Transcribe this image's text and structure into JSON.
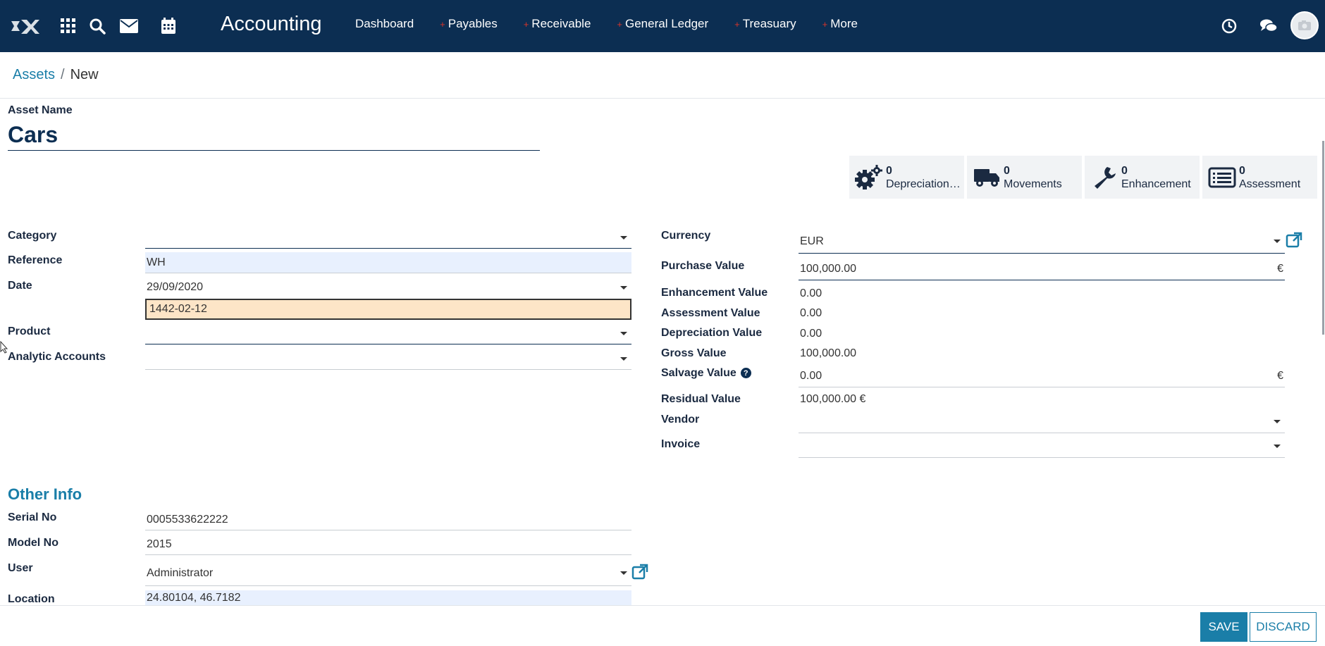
{
  "app": {
    "title": "Accounting",
    "colors": {
      "navbar": "#0c2e52",
      "accent": "#1a7ea8",
      "required_bg": "#e8f0fe",
      "focus_bg": "#fde5c7"
    }
  },
  "nav": {
    "icons": [
      "apps-grid-icon",
      "search-icon",
      "mail-icon",
      "calendar-icon"
    ],
    "menu": [
      {
        "label": "Dashboard",
        "plus": ""
      },
      {
        "label": "Payables",
        "plus": "+"
      },
      {
        "label": "Receivable",
        "plus": "+"
      },
      {
        "label": "General Ledger",
        "plus": "+"
      },
      {
        "label": "Treasuary",
        "plus": "+"
      },
      {
        "label": "More",
        "plus": "+"
      }
    ]
  },
  "breadcrumb": {
    "parent": "Assets",
    "sep": "/",
    "current": "New"
  },
  "asset": {
    "label": "Asset Name",
    "name": "Cars"
  },
  "smart_buttons": [
    {
      "count": "0",
      "label": "Depreciations..."
    },
    {
      "count": "0",
      "label": "Movements"
    },
    {
      "count": "0",
      "label": "Enhancement"
    },
    {
      "count": "0",
      "label": "Assessment"
    }
  ],
  "left_fields": {
    "category": {
      "label": "Category",
      "value": ""
    },
    "reference": {
      "label": "Reference",
      "value": "WH"
    },
    "date": {
      "label": "Date",
      "value": "29/09/2020",
      "hijri": "1442-02-12"
    },
    "product": {
      "label": "Product",
      "value": ""
    },
    "analytic": {
      "label": "Analytic Accounts",
      "value": ""
    }
  },
  "right_fields": {
    "currency": {
      "label": "Currency",
      "value": "EUR"
    },
    "purchase": {
      "label": "Purchase Value",
      "value": "100,000.00",
      "symbol": "€"
    },
    "enhancement": {
      "label": "Enhancement Value",
      "value": "0.00"
    },
    "assessment": {
      "label": "Assessment Value",
      "value": "0.00"
    },
    "depreciation": {
      "label": "Depreciation Value",
      "value": "0.00"
    },
    "gross": {
      "label": "Gross Value",
      "value": "100,000.00"
    },
    "salvage": {
      "label": "Salvage Value",
      "help": "?",
      "value": "0.00",
      "symbol": "€"
    },
    "residual": {
      "label": "Residual Value",
      "value": "100,000.00 €"
    },
    "vendor": {
      "label": "Vendor",
      "value": ""
    },
    "invoice": {
      "label": "Invoice",
      "value": ""
    }
  },
  "other_info": {
    "title": "Other Info",
    "serial": {
      "label": "Serial No",
      "value": "0005533622222"
    },
    "model": {
      "label": "Model No",
      "value": "2015"
    },
    "user": {
      "label": "User",
      "value": "Administrator"
    },
    "location": {
      "label": "Location",
      "value": "24.80104, 46.7182"
    }
  },
  "actions": {
    "save": "SAVE",
    "discard": "DISCARD"
  }
}
